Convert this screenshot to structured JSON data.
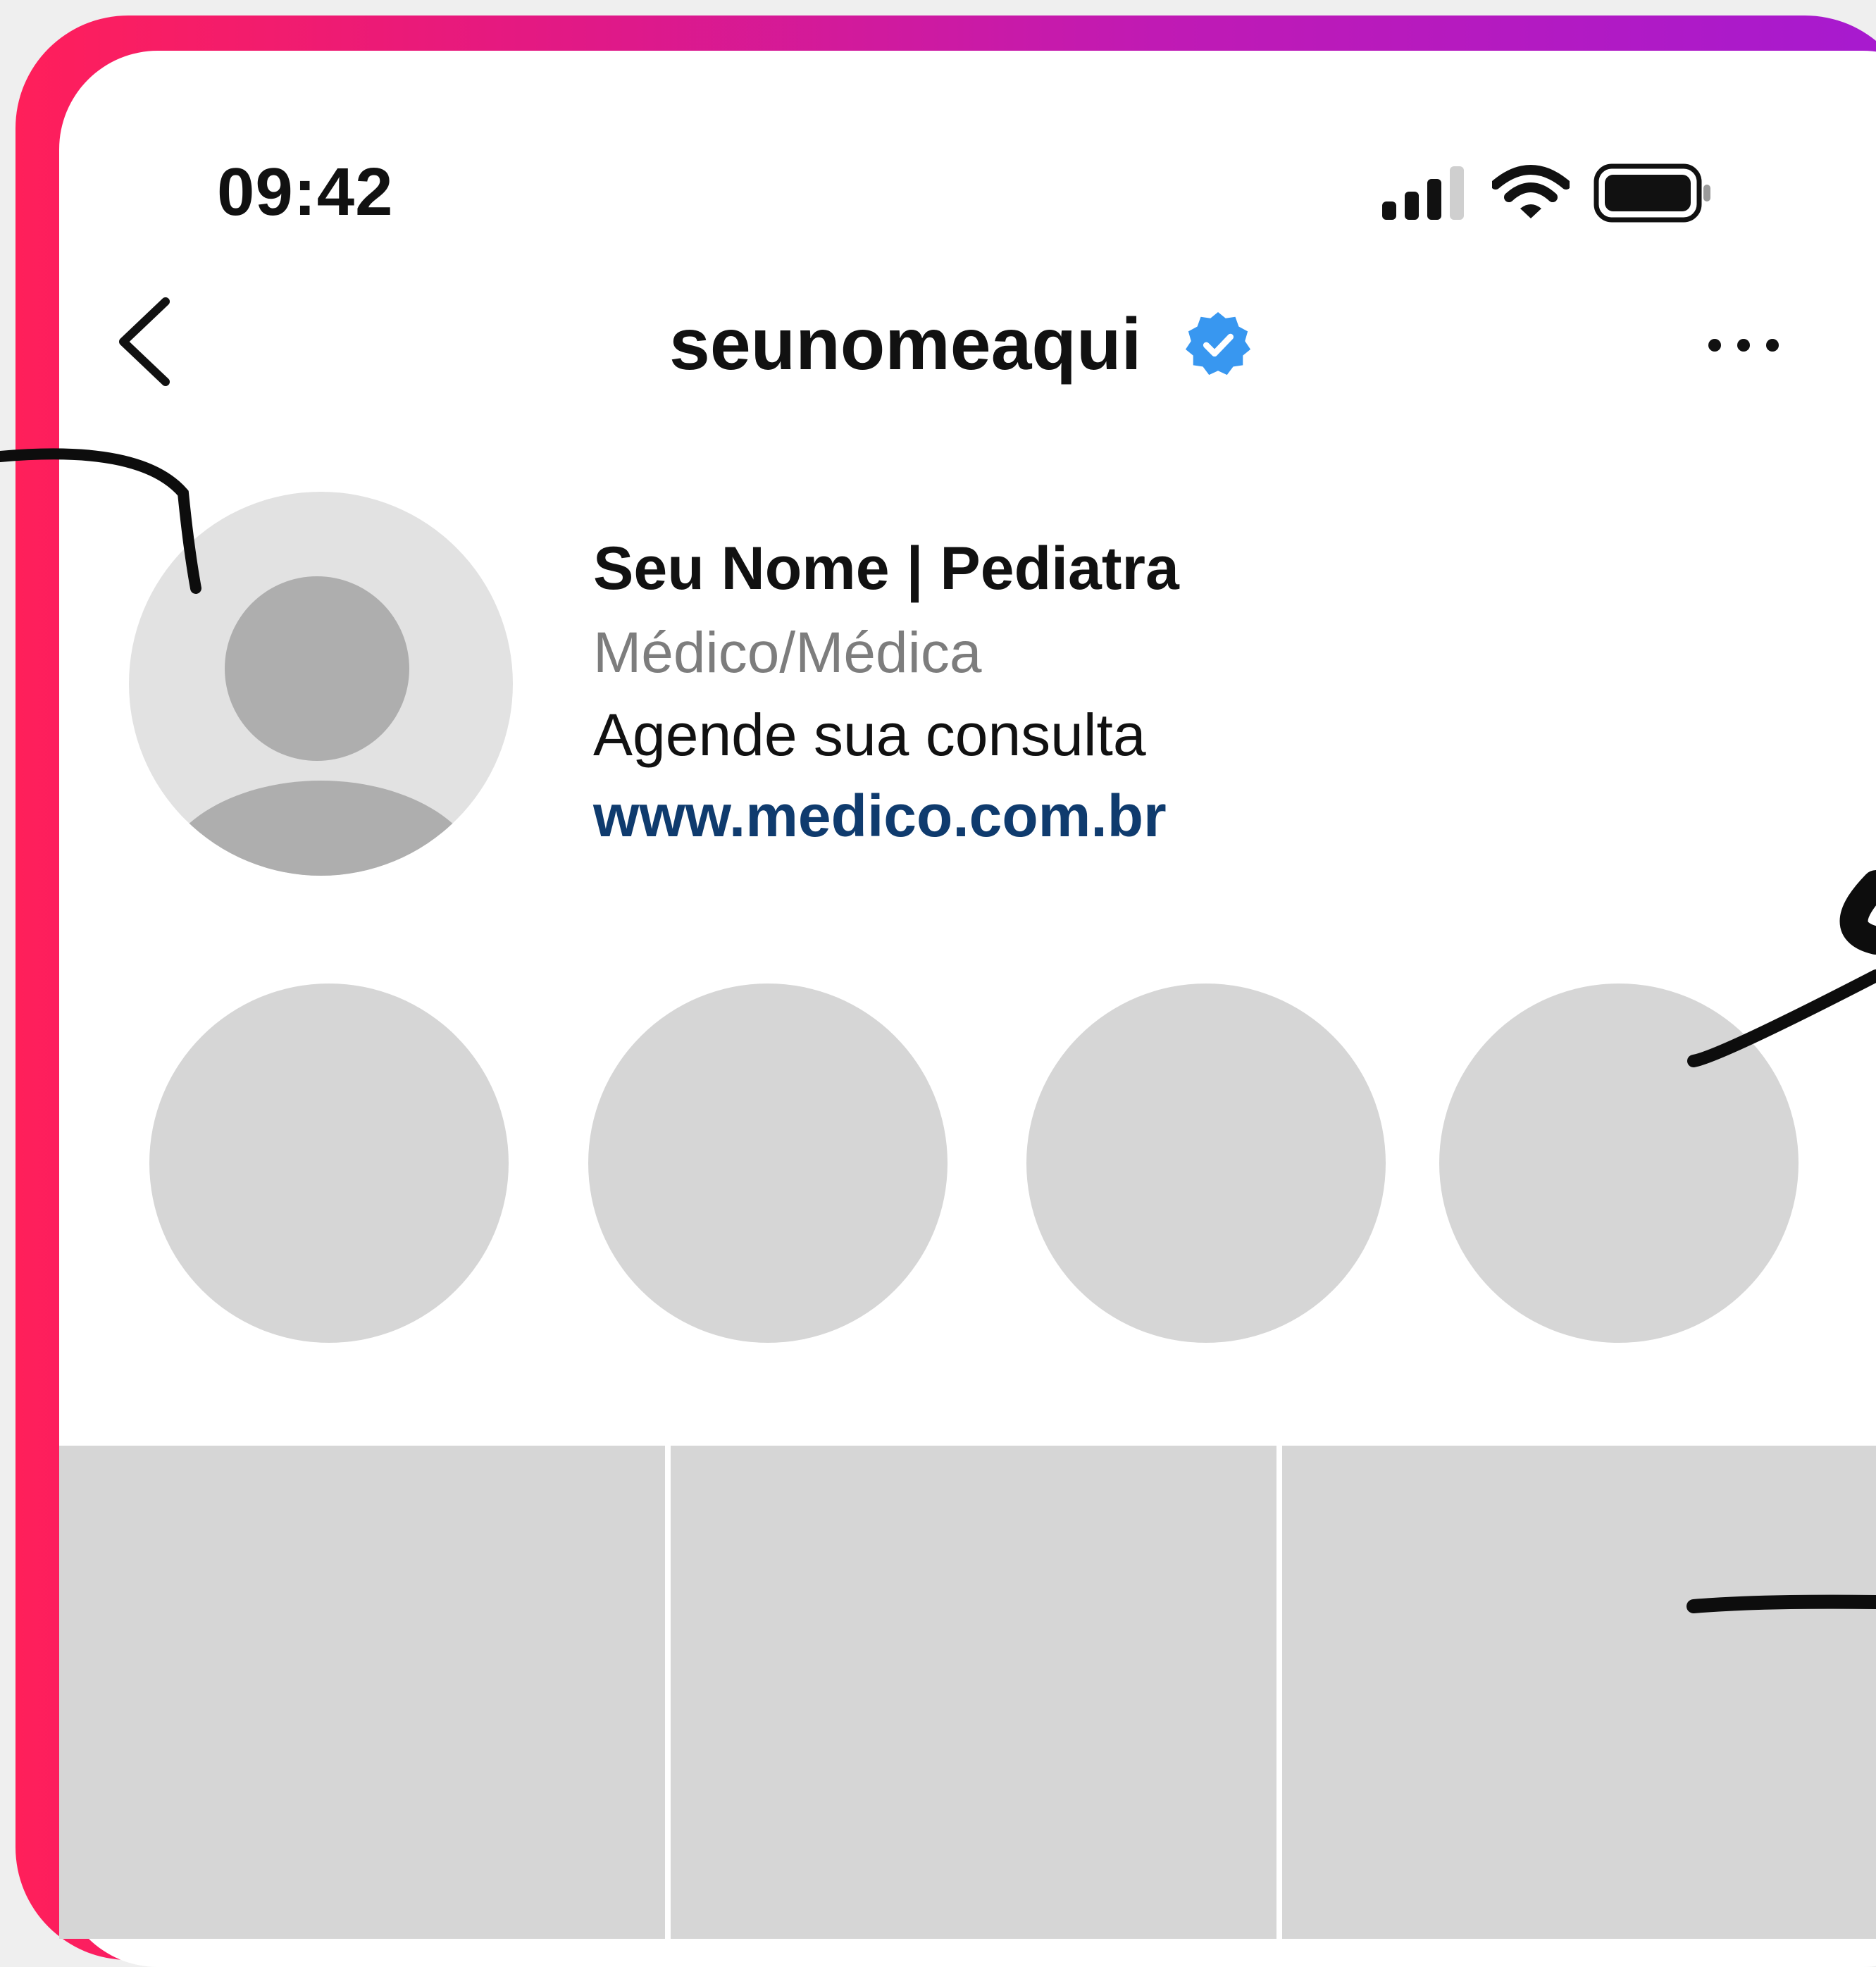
{
  "status_bar": {
    "time": "09:42",
    "icons": [
      "cellular-signal-icon",
      "wifi-icon",
      "battery-icon"
    ]
  },
  "header": {
    "username": "seunomeaqui",
    "verified_icon": "verified-badge-icon",
    "back_icon": "chevron-left-icon",
    "more_icon": "more-horizontal-icon"
  },
  "profile": {
    "display_name": "Seu Nome | Pediatra",
    "category": "Médico/Médica",
    "bio": "Agende sua consulta",
    "link": "www.medico.com.br"
  },
  "highlights": [
    {},
    {},
    {},
    {}
  ],
  "posts": [
    {},
    {},
    {}
  ],
  "colors": {
    "frame_gradient_start": "#ff1f5a",
    "frame_gradient_end": "#a61ad0",
    "verified": "#3897f0",
    "link": "#0f3b6e",
    "placeholder": "#d6d6d6"
  }
}
